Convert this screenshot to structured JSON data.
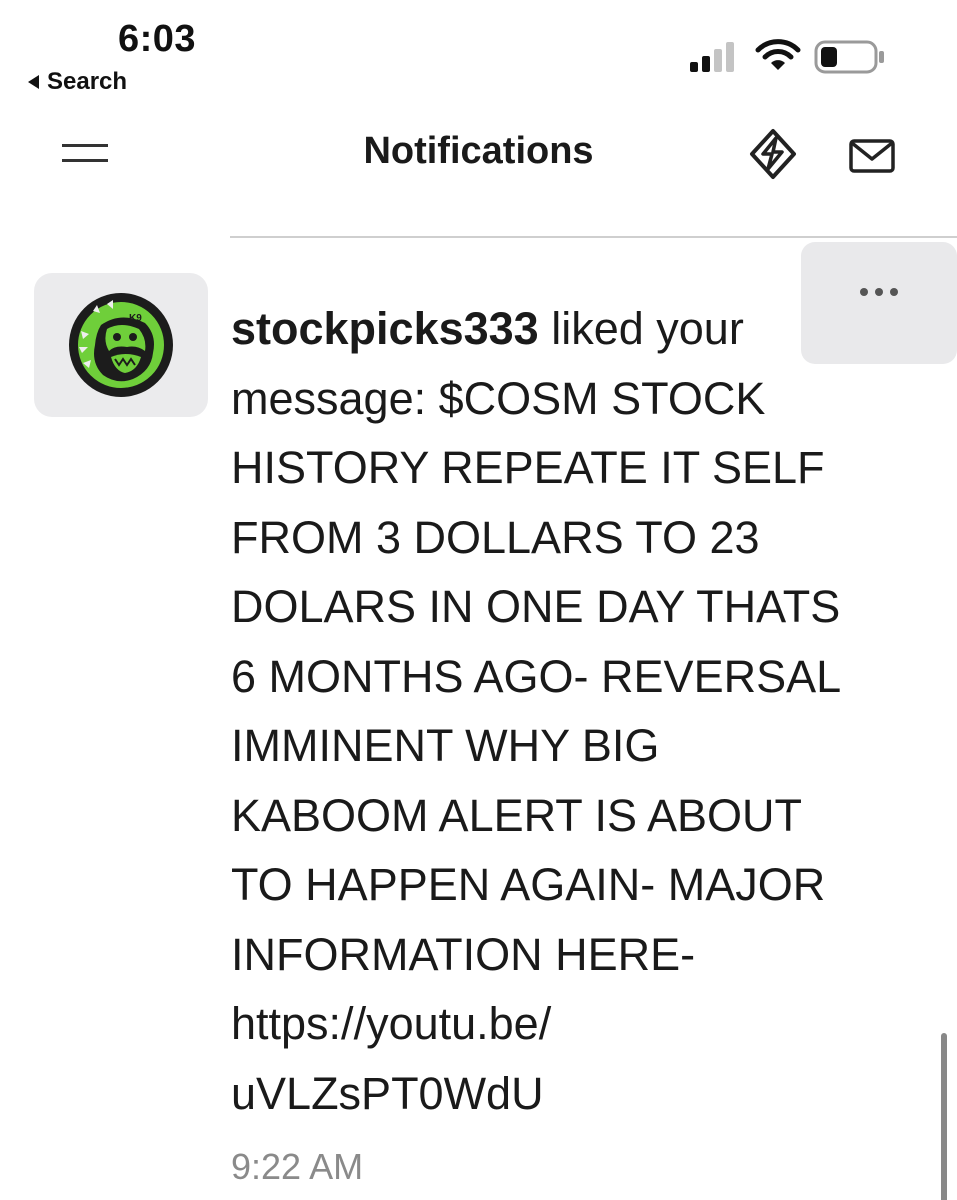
{
  "status_bar": {
    "time": "6:03",
    "back_label": "Search",
    "icons": [
      "cellular-signal-icon",
      "wifi-icon",
      "battery-low-icon"
    ]
  },
  "header": {
    "title": "Notifications",
    "icons": [
      "menu-icon",
      "diamond-icon",
      "mail-icon"
    ]
  },
  "notification": {
    "username": "stockpicks333",
    "action": " liked your message: ",
    "message_lines": [
      "$COSM STOCK",
      "HISTORY REPEATE IT SELF",
      "FROM 3 DOLLARS TO 23",
      "DOLARS IN ONE DAY THATS",
      "6 MONTHS AGO- REVERSAL",
      "IMMINENT WHY BIG",
      "KABOOM ALERT IS ABOUT",
      "TO HAPPEN AGAIN- MAJOR",
      "INFORMATION HERE-",
      "https://youtu.be/",
      "uVLZsPT0WdU"
    ],
    "timestamp": "9:22 AM",
    "avatar_icon": "bulldog-avatar-icon",
    "more_icon": "more-options-icon"
  },
  "colors": {
    "avatar_green": "#6fcf3a",
    "avatar_dark": "#1c1c1c",
    "tile_background": "#ebebed",
    "timestamp_gray": "#8a8a8a"
  }
}
